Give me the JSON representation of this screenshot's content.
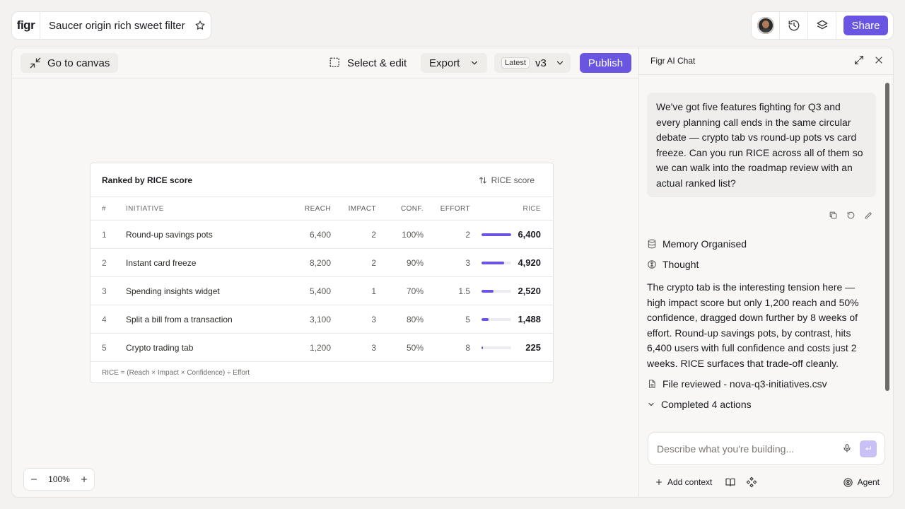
{
  "app": {
    "logo": "figr",
    "project_title": "Saucer origin rich sweet filter",
    "share_label": "Share"
  },
  "canvas_toolbar": {
    "goto_canvas": "Go to canvas",
    "select_edit": "Select & edit",
    "export": "Export",
    "latest_badge": "Latest",
    "version": "v3",
    "publish": "Publish"
  },
  "table_card": {
    "title": "Ranked by RICE score",
    "sort_label": "RICE score",
    "headers": {
      "num": "#",
      "initiative": "INITIATIVE",
      "reach": "REACH",
      "impact": "IMPACT",
      "conf": "CONF.",
      "effort": "EFFORT",
      "rice": "RICE"
    },
    "rows": [
      {
        "num": "1",
        "initiative": "Round-up savings pots",
        "reach": "6,400",
        "impact": "2",
        "conf": "100%",
        "effort": "2",
        "rice": "6,400",
        "rice_value": 6400
      },
      {
        "num": "2",
        "initiative": "Instant card freeze",
        "reach": "8,200",
        "impact": "2",
        "conf": "90%",
        "effort": "3",
        "rice": "4,920",
        "rice_value": 4920
      },
      {
        "num": "3",
        "initiative": "Spending insights widget",
        "reach": "5,400",
        "impact": "1",
        "conf": "70%",
        "effort": "1.5",
        "rice": "2,520",
        "rice_value": 2520
      },
      {
        "num": "4",
        "initiative": "Split a bill from a transaction",
        "reach": "3,100",
        "impact": "3",
        "conf": "80%",
        "effort": "5",
        "rice": "1,488",
        "rice_value": 1488
      },
      {
        "num": "5",
        "initiative": "Crypto trading tab",
        "reach": "1,200",
        "impact": "3",
        "conf": "50%",
        "effort": "8",
        "rice": "225",
        "rice_value": 225
      }
    ],
    "footnote": "RICE = (Reach × Impact × Confidence) ÷ Effort"
  },
  "zoom": {
    "level": "100%"
  },
  "chat": {
    "title": "Figr AI Chat",
    "user_message": "We've got five features fighting for Q3 and every planning call ends in the same circular debate — crypto tab vs round-up pots vs card freeze. Can you run RICE across all of them so we can walk into the roadmap review with an actual ranked list?",
    "memory_status": "Memory Organised",
    "thought_status": "Thought",
    "ai_response": "The crypto tab is the interesting tension here — high impact score but only 1,200 reach and 50% confidence, dragged down further by 8 weeks of effort. Round-up savings pots, by contrast, hits 6,400 users with full confidence and costs just 2 weeks. RICE surfaces that trade-off cleanly.",
    "file_status": "File reviewed - nova-q3-initiatives.csv",
    "completed": "Completed 4 actions",
    "input_placeholder": "Describe what you're building...",
    "add_context": "Add context",
    "agent_label": "Agent"
  },
  "colors": {
    "accent": "#6a55e3",
    "accent_light": "#c9c0f5"
  }
}
